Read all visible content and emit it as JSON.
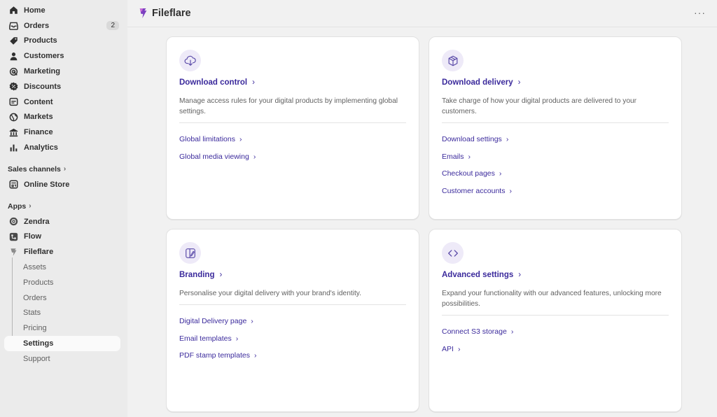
{
  "sidebar": {
    "main_items": [
      {
        "label": "Home",
        "icon": "home-icon"
      },
      {
        "label": "Orders",
        "icon": "inbox-icon",
        "badge": "2"
      },
      {
        "label": "Products",
        "icon": "tag-icon"
      },
      {
        "label": "Customers",
        "icon": "person-icon"
      },
      {
        "label": "Marketing",
        "icon": "target-icon"
      },
      {
        "label": "Discounts",
        "icon": "discount-icon"
      },
      {
        "label": "Content",
        "icon": "content-icon"
      },
      {
        "label": "Markets",
        "icon": "globe-icon"
      },
      {
        "label": "Finance",
        "icon": "bank-icon"
      },
      {
        "label": "Analytics",
        "icon": "bar-chart-icon"
      }
    ],
    "sales_channels_label": "Sales channels",
    "online_store_label": "Online Store",
    "apps_label": "Apps",
    "apps": [
      {
        "label": "Zendra"
      },
      {
        "label": "Flow"
      },
      {
        "label": "Fileflare"
      }
    ],
    "fileflare_sub": [
      {
        "label": "Assets"
      },
      {
        "label": "Products"
      },
      {
        "label": "Orders"
      },
      {
        "label": "Stats"
      },
      {
        "label": "Pricing"
      },
      {
        "label": "Settings",
        "active": true
      },
      {
        "label": "Support"
      }
    ]
  },
  "header": {
    "title": "Fileflare",
    "more_label": "···"
  },
  "cards": {
    "download_control": {
      "title": "Download control",
      "description": "Manage access rules for your digital products by implementing global settings.",
      "links": [
        "Global limitations",
        "Global media viewing"
      ]
    },
    "download_delivery": {
      "title": "Download delivery",
      "description": "Take charge of how your digital products are delivered to your customers.",
      "links": [
        "Download settings",
        "Emails",
        "Checkout pages",
        "Customer accounts"
      ]
    },
    "branding": {
      "title": "Branding",
      "description": "Personalise your digital delivery with your brand's identity.",
      "links": [
        "Digital Delivery page",
        "Email templates",
        "PDF stamp templates"
      ]
    },
    "advanced_settings": {
      "title": "Advanced settings",
      "description": "Expand your functionality with our advanced features, unlocking more possibilities.",
      "links": [
        "Connect S3 storage",
        "API"
      ]
    }
  },
  "chevron": "›",
  "colors": {
    "link": "#3b2a9c",
    "icon_bg": "#eeeaf8",
    "sidebar_bg": "#ebebeb",
    "page_bg": "#f1f1f1"
  }
}
